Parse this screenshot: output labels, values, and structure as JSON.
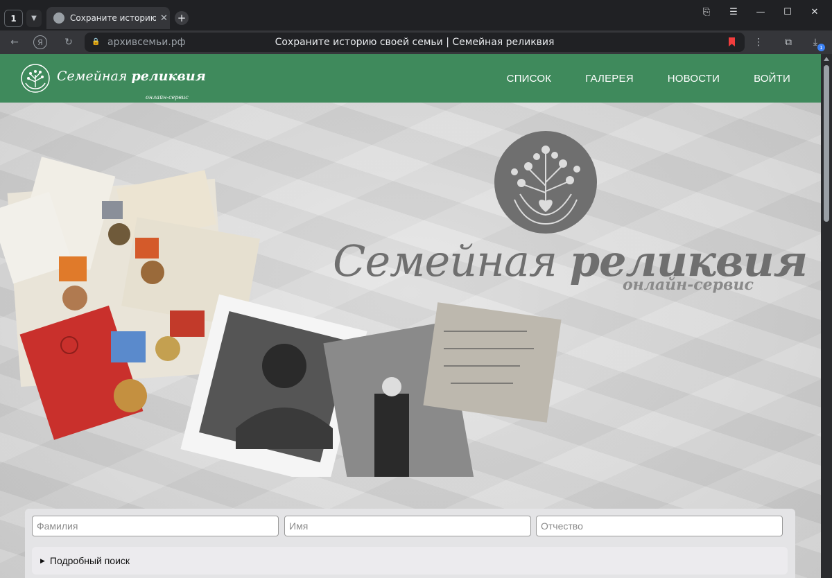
{
  "browser": {
    "tab_count": "1",
    "tab_title": "Сохраните историю св",
    "url": "архивсемьи.рф",
    "page_title": "Сохраните историю своей семьи | Семейная реликвия",
    "download_badge": "1"
  },
  "site": {
    "logo_main": "Семейная ",
    "logo_bold": "реликвия",
    "logo_sub": "онлайн-сервис",
    "nav": [
      "СПИСОК",
      "ГАЛЕРЕЯ",
      "НОВОСТИ",
      "ВОЙТИ"
    ]
  },
  "hero": {
    "brand_main": "Семейная ",
    "brand_bold": "реликвия",
    "brand_sub": "онлайн-сервис"
  },
  "search": {
    "surname_placeholder": "Фамилия",
    "name_placeholder": "Имя",
    "patronymic_placeholder": "Отчество",
    "advanced_label": "Подробный поиск"
  },
  "colors": {
    "header_green": "#3f8a5c",
    "bookmark_red": "#f23d3d"
  }
}
